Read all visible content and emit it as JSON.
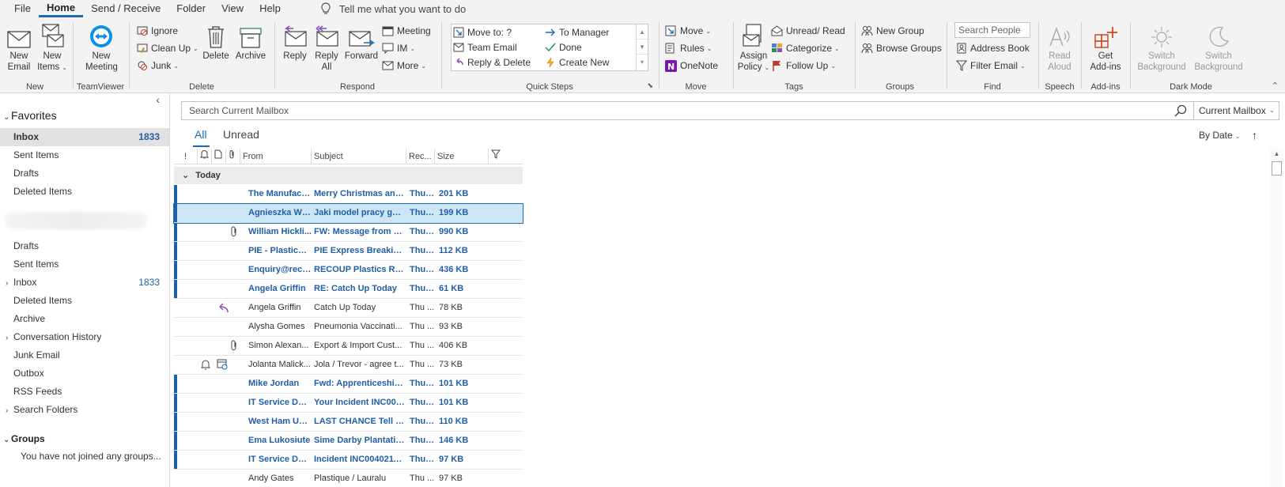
{
  "menu": {
    "tabs": [
      "File",
      "Home",
      "Send / Receive",
      "Folder",
      "View",
      "Help"
    ],
    "active": "Home",
    "tell_me": "Tell me what you want to do"
  },
  "ribbon": {
    "new": {
      "new_email": [
        "New",
        "Email"
      ],
      "new_items": [
        "New",
        "Items"
      ],
      "label": "New"
    },
    "teamviewer": {
      "new_meeting": [
        "New",
        "Meeting"
      ],
      "label": "TeamViewer"
    },
    "delete": {
      "ignore": "Ignore",
      "clean_up": "Clean Up",
      "junk": "Junk",
      "delete": "Delete",
      "archive": "Archive",
      "label": "Delete"
    },
    "respond": {
      "reply": "Reply",
      "reply_all": [
        "Reply",
        "All"
      ],
      "forward": "Forward",
      "meeting": "Meeting",
      "im": "IM",
      "more": "More",
      "label": "Respond"
    },
    "quick_steps": {
      "items": [
        "Move to: ?",
        "To Manager",
        "Team Email",
        "Done",
        "Reply & Delete",
        "Create New"
      ],
      "label": "Quick Steps"
    },
    "move": {
      "move": "Move",
      "rules": "Rules",
      "onenote": "OneNote",
      "label": "Move"
    },
    "tags": {
      "assign_policy": [
        "Assign",
        "Policy"
      ],
      "unread_read": "Unread/ Read",
      "categorize": "Categorize",
      "follow_up": "Follow Up",
      "label": "Tags"
    },
    "groups": {
      "new_group": "New Group",
      "browse_groups": "Browse Groups",
      "label": "Groups"
    },
    "find": {
      "search_people": "Search People",
      "address_book": "Address Book",
      "filter_email": "Filter Email",
      "label": "Find"
    },
    "speech": {
      "read_aloud": [
        "Read",
        "Aloud"
      ],
      "label": "Speech"
    },
    "addins": {
      "get_addins": [
        "Get",
        "Add-ins"
      ],
      "label": "Add-ins"
    },
    "dark_mode": {
      "switch_bg_1": [
        "Switch",
        "Background"
      ],
      "switch_bg_2": [
        "Switch",
        "Background"
      ],
      "label": "Dark Mode"
    }
  },
  "nav": {
    "favorites_label": "Favorites",
    "favorites": [
      {
        "name": "Inbox",
        "count": "1833"
      },
      {
        "name": "Sent Items",
        "count": ""
      },
      {
        "name": "Drafts",
        "count": ""
      },
      {
        "name": "Deleted Items",
        "count": ""
      }
    ],
    "folders": [
      {
        "name": "Drafts",
        "count": "",
        "caret": ""
      },
      {
        "name": "Sent Items",
        "count": "",
        "caret": ""
      },
      {
        "name": "Inbox",
        "count": "1833",
        "caret": "›"
      },
      {
        "name": "Deleted Items",
        "count": "",
        "caret": ""
      },
      {
        "name": "Archive",
        "count": "",
        "caret": ""
      },
      {
        "name": "Conversation History",
        "count": "",
        "caret": "›"
      },
      {
        "name": "Junk Email",
        "count": "",
        "caret": ""
      },
      {
        "name": "Outbox",
        "count": "",
        "caret": ""
      },
      {
        "name": "RSS Feeds",
        "count": "",
        "caret": ""
      },
      {
        "name": "Search Folders",
        "count": "",
        "caret": "›"
      }
    ],
    "groups_label": "Groups",
    "groups_empty": "You have not joined any groups..."
  },
  "search": {
    "placeholder": "Search Current Mailbox",
    "scope": "Current Mailbox"
  },
  "filters": {
    "all": "All",
    "unread": "Unread",
    "sort": "By Date"
  },
  "list": {
    "columns": {
      "from": "From",
      "subject": "Subject",
      "received": "Rec...",
      "size": "Size"
    },
    "group_today": "Today",
    "rows": [
      {
        "from": "The Manufact...",
        "subject": "Merry Christmas and ...",
        "received": "Thu ...",
        "size": "201 KB",
        "unread": true,
        "selected": false,
        "attach": false,
        "replied": false,
        "flags": false
      },
      {
        "from": "Agnieszka Wó...",
        "subject": "Jaki model pracy gwa...",
        "received": "Thu ...",
        "size": "199 KB",
        "unread": true,
        "selected": true,
        "attach": false,
        "replied": false,
        "flags": false
      },
      {
        "from": "William Hickli...",
        "subject": "FW: Message from D...",
        "received": "Thu ...",
        "size": "990 KB",
        "unread": true,
        "selected": false,
        "attach": true,
        "replied": false,
        "flags": false
      },
      {
        "from": "PIE - Plastics I...",
        "subject": "PIE Express Breaking ...",
        "received": "Thu ...",
        "size": "112 KB",
        "unread": true,
        "selected": false,
        "attach": false,
        "replied": false,
        "flags": false
      },
      {
        "from": "Enquiry@reco...",
        "subject": "RECOUP Plastics Reso...",
        "received": "Thu ...",
        "size": "436 KB",
        "unread": true,
        "selected": false,
        "attach": false,
        "replied": false,
        "flags": false
      },
      {
        "from": "Angela Griffin",
        "subject": "RE: Catch Up Today",
        "received": "Thu ...",
        "size": "61 KB",
        "unread": true,
        "selected": false,
        "attach": false,
        "replied": false,
        "flags": false
      },
      {
        "from": "Angela Griffin",
        "subject": "Catch Up Today",
        "received": "Thu ...",
        "size": "78 KB",
        "unread": false,
        "selected": false,
        "attach": false,
        "replied": true,
        "flags": false
      },
      {
        "from": "Alysha Gomes",
        "subject": "Pneumonia Vaccinati...",
        "received": "Thu ...",
        "size": "93 KB",
        "unread": false,
        "selected": false,
        "attach": false,
        "replied": false,
        "flags": false
      },
      {
        "from": "Simon Alexan...",
        "subject": "Export & Import Cust...",
        "received": "Thu ...",
        "size": "406 KB",
        "unread": false,
        "selected": false,
        "attach": true,
        "replied": false,
        "flags": false
      },
      {
        "from": "Jolanta Malick...",
        "subject": "Jola / Trevor - agree t...",
        "received": "Thu ...",
        "size": "73 KB",
        "unread": false,
        "selected": false,
        "attach": false,
        "replied": false,
        "flags": true
      },
      {
        "from": "Mike Jordan",
        "subject": "Fwd: Apprenticeship ...",
        "received": "Thu ...",
        "size": "101 KB",
        "unread": true,
        "selected": false,
        "attach": false,
        "replied": false,
        "flags": false
      },
      {
        "from": "IT Service Desk",
        "subject": "Your Incident INC004...",
        "received": "Thu ...",
        "size": "101 KB",
        "unread": true,
        "selected": false,
        "attach": false,
        "replied": false,
        "flags": false
      },
      {
        "from": "West Ham Uni...",
        "subject": "LAST CHANCE Tell us ...",
        "received": "Thu ...",
        "size": "110 KB",
        "unread": true,
        "selected": false,
        "attach": false,
        "replied": false,
        "flags": false
      },
      {
        "from": "Ema Lukosiute",
        "subject": "Sime Darby Plantatio...",
        "received": "Thu ...",
        "size": "146 KB",
        "unread": true,
        "selected": false,
        "attach": false,
        "replied": false,
        "flags": false
      },
      {
        "from": "IT Service Desk",
        "subject": "Incident INC0040211 ...",
        "received": "Thu ...",
        "size": "97 KB",
        "unread": true,
        "selected": false,
        "attach": false,
        "replied": false,
        "flags": false
      },
      {
        "from": "Andy Gates",
        "subject": "Plastique / Lauralu",
        "received": "Thu ...",
        "size": "97 KB",
        "unread": false,
        "selected": false,
        "attach": false,
        "replied": false,
        "flags": false
      }
    ]
  },
  "colors": {
    "accent": "#1f66b3",
    "unread": "#1f5fa8",
    "selected_row": "#cde6f7",
    "onenote": "#7719aa",
    "addins": "#d24726",
    "junk": "#c0392b"
  }
}
